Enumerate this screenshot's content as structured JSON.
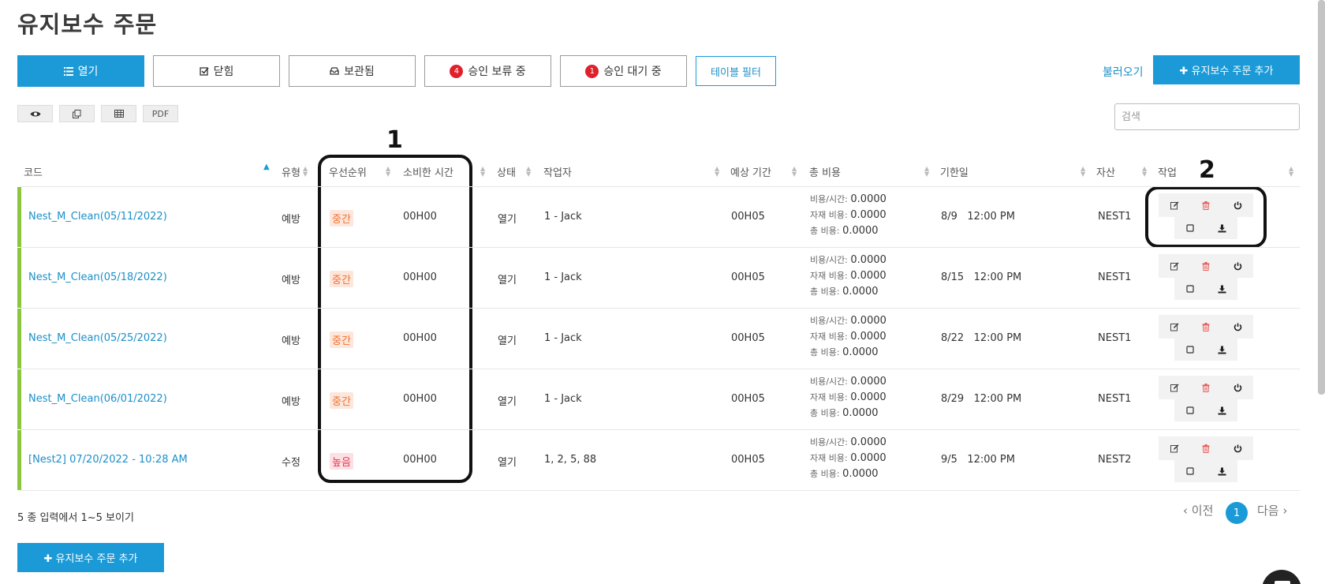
{
  "page": {
    "title": "유지보수 주문"
  },
  "tabs": [
    {
      "label": "열기",
      "icon": "list-icon",
      "active": true
    },
    {
      "label": "닫힘",
      "icon": "checkbox-icon"
    },
    {
      "label": "보관됨",
      "icon": "inbox-icon"
    },
    {
      "label": "승인 보류 중",
      "badge": "4"
    },
    {
      "label": "승인 대기 중",
      "badge": "1"
    }
  ],
  "table_filter_label": "테이블 필터",
  "import_label": "불러오기",
  "add_button_label": "✚ 유지보수 주문 추가",
  "tools": [
    {
      "name": "eye-icon"
    },
    {
      "name": "copy-icon"
    },
    {
      "name": "table-icon"
    },
    {
      "label": "PDF"
    }
  ],
  "search": {
    "placeholder": "검색"
  },
  "annotations": {
    "one": "1",
    "two": "2"
  },
  "columns": {
    "code": "코드",
    "type": "유형",
    "priority": "우선순위",
    "time_spent": "소비한 시간",
    "status": "상태",
    "worker": "작업자",
    "estimated": "예상 기간",
    "total_cost": "총 비용",
    "due": "기한일",
    "asset": "자산",
    "actions": "작업"
  },
  "cost_labels": {
    "per_hour": "비용/시간:",
    "material": "자재 비용:",
    "total": "총 비용:"
  },
  "rows": [
    {
      "code": "Nest_M_Clean(05/11/2022)",
      "type": "예방",
      "priority": "중간",
      "priority_level": "mid",
      "time_spent": "00H00",
      "status": "열기",
      "worker": "1 - Jack",
      "estimated": "00H05",
      "per_hour": "0.0000",
      "material": "0.0000",
      "total": "0.0000",
      "due_date": "8/9",
      "due_time": "12:00 PM",
      "asset": "NEST1"
    },
    {
      "code": "Nest_M_Clean(05/18/2022)",
      "type": "예방",
      "priority": "중간",
      "priority_level": "mid",
      "time_spent": "00H00",
      "status": "열기",
      "worker": "1 - Jack",
      "estimated": "00H05",
      "per_hour": "0.0000",
      "material": "0.0000",
      "total": "0.0000",
      "due_date": "8/15",
      "due_time": "12:00 PM",
      "asset": "NEST1"
    },
    {
      "code": "Nest_M_Clean(05/25/2022)",
      "type": "예방",
      "priority": "중간",
      "priority_level": "mid",
      "time_spent": "00H00",
      "status": "열기",
      "worker": "1 - Jack",
      "estimated": "00H05",
      "per_hour": "0.0000",
      "material": "0.0000",
      "total": "0.0000",
      "due_date": "8/22",
      "due_time": "12:00 PM",
      "asset": "NEST1"
    },
    {
      "code": "Nest_M_Clean(06/01/2022)",
      "type": "예방",
      "priority": "중간",
      "priority_level": "mid",
      "time_spent": "00H00",
      "status": "열기",
      "worker": "1 - Jack",
      "estimated": "00H05",
      "per_hour": "0.0000",
      "material": "0.0000",
      "total": "0.0000",
      "due_date": "8/29",
      "due_time": "12:00 PM",
      "asset": "NEST1"
    },
    {
      "code": "[Nest2] 07/20/2022 - 10:28 AM",
      "type": "수정",
      "priority": "높음",
      "priority_level": "high",
      "time_spent": "00H00",
      "status": "열기",
      "worker": "1, 2, 5, 88",
      "estimated": "00H05",
      "per_hour": "0.0000",
      "material": "0.0000",
      "total": "0.0000",
      "due_date": "9/5",
      "due_time": "12:00 PM",
      "asset": "NEST2"
    }
  ],
  "footer": {
    "entries": "5 종 입력에서 1~5 보이기",
    "prev": "‹ 이전",
    "page": "1",
    "next": "다음 ›"
  },
  "colors": {
    "accent": "#1b9ad7",
    "row_bar": "#8cc63f",
    "badge": "#e0202a",
    "priority_mid": "#f07030",
    "priority_high": "#e23a55",
    "delete_icon": "#e85a5a"
  }
}
